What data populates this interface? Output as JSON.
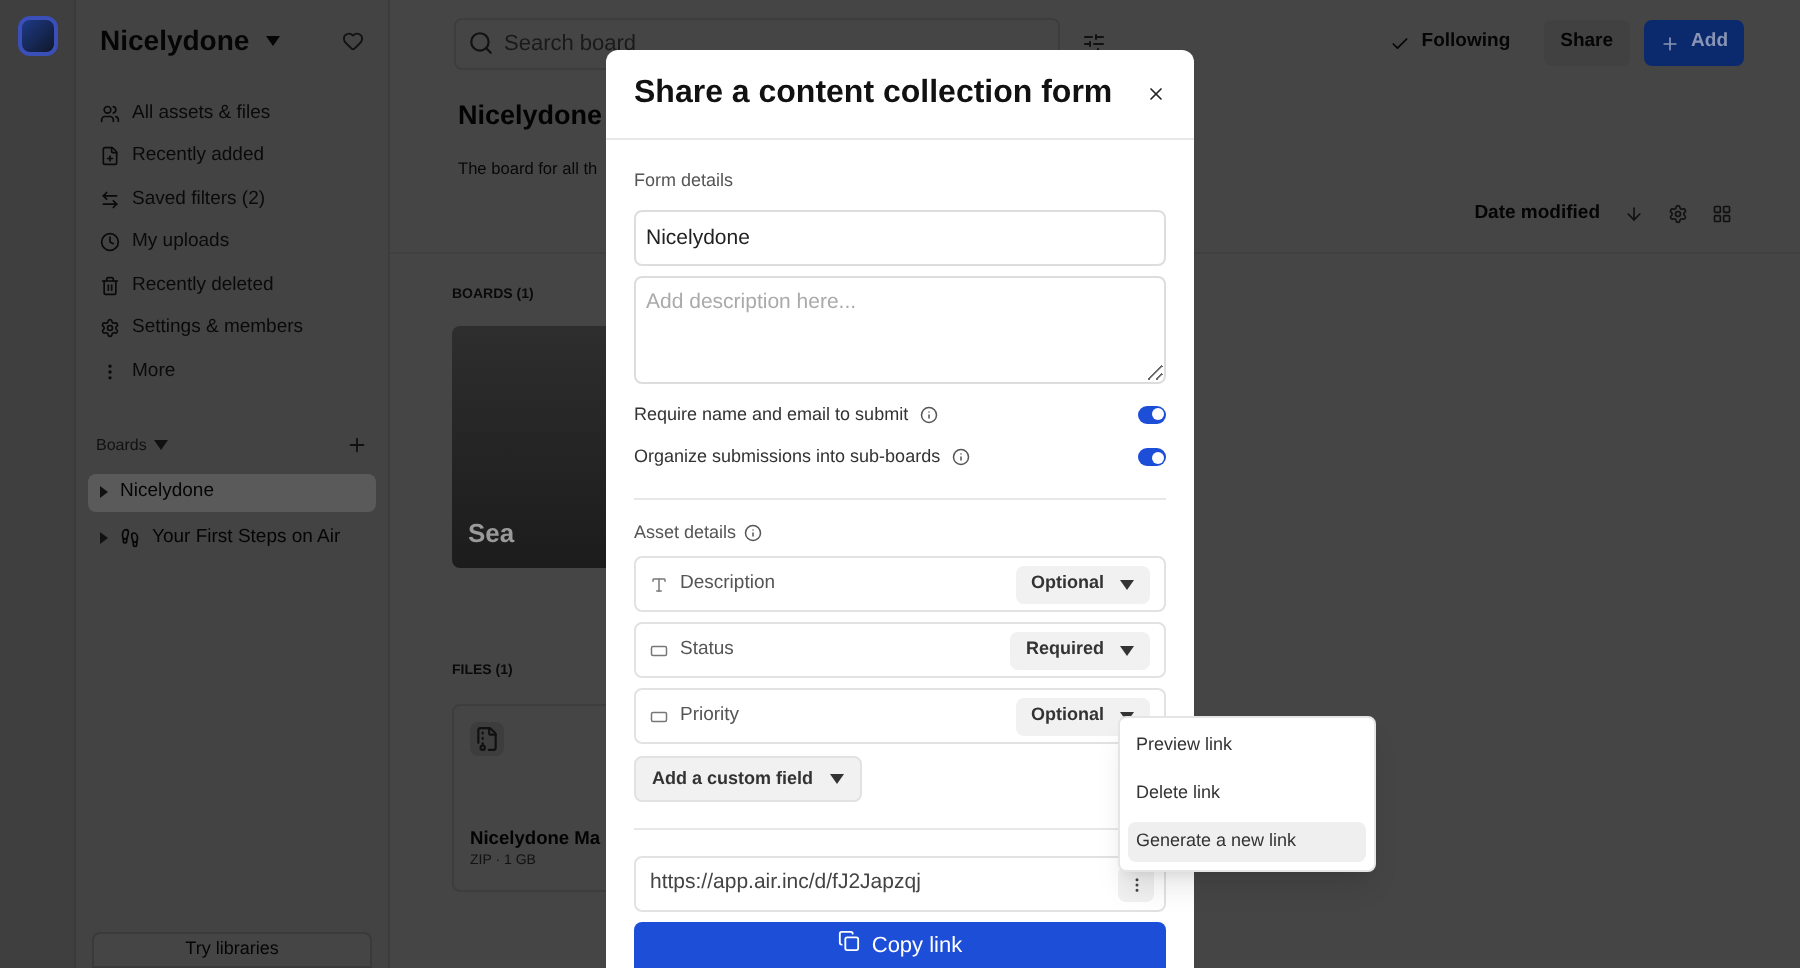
{
  "workspace": {
    "name": "Nicelydone"
  },
  "sidebar": {
    "nav": [
      {
        "label": "All assets & files"
      },
      {
        "label": "Recently added"
      },
      {
        "label": "Saved filters (2)"
      },
      {
        "label": "My uploads"
      },
      {
        "label": "Recently deleted"
      },
      {
        "label": "Settings & members"
      },
      {
        "label": "More"
      }
    ],
    "boards_header": "Boards",
    "boards": [
      {
        "label": "Nicelydone",
        "selected": true,
        "kind": "plain"
      },
      {
        "label": "Your First Steps on Air",
        "selected": false,
        "kind": "footprints"
      }
    ],
    "footer_button": "Try libraries"
  },
  "topbar": {
    "search": {
      "placeholder": "Search board"
    },
    "following": {
      "label": "Following",
      "checked": true
    },
    "share": "Share",
    "add": "Add"
  },
  "board": {
    "title": "Nicelydone",
    "description": "The board for all th",
    "sort": "Date modified",
    "boards_section": "BOARDS (1)",
    "board_cards": [
      {
        "name": "Sea"
      }
    ],
    "files_section": "FILES (1)",
    "file_cards": [
      {
        "name": "Nicelydone Ma",
        "meta": "ZIP · 1 GB"
      }
    ]
  },
  "modal": {
    "title": "Share a content collection form",
    "form_details": "Form details",
    "name_value": "Nicelydone",
    "description": {
      "placeholder": "Add description here..."
    },
    "toggles": [
      {
        "label": "Require name and email to submit",
        "on": true
      },
      {
        "label": "Organize submissions into sub-boards",
        "on": true
      }
    ],
    "asset_details": "Asset details",
    "fields": [
      {
        "name": "Description",
        "kind": "text",
        "requirement": "Optional"
      },
      {
        "name": "Status",
        "kind": "select",
        "requirement": "Required"
      },
      {
        "name": "Priority",
        "kind": "select",
        "requirement": "Optional"
      }
    ],
    "add_field": "Add a custom field",
    "link": "https://app.air.inc/d/fJ2Japzqj",
    "copy": "Copy link"
  },
  "link_menu": {
    "items": [
      {
        "label": "Preview link",
        "selected": false
      },
      {
        "label": "Delete link",
        "selected": false
      },
      {
        "label": "Generate a new link",
        "selected": true
      }
    ]
  }
}
